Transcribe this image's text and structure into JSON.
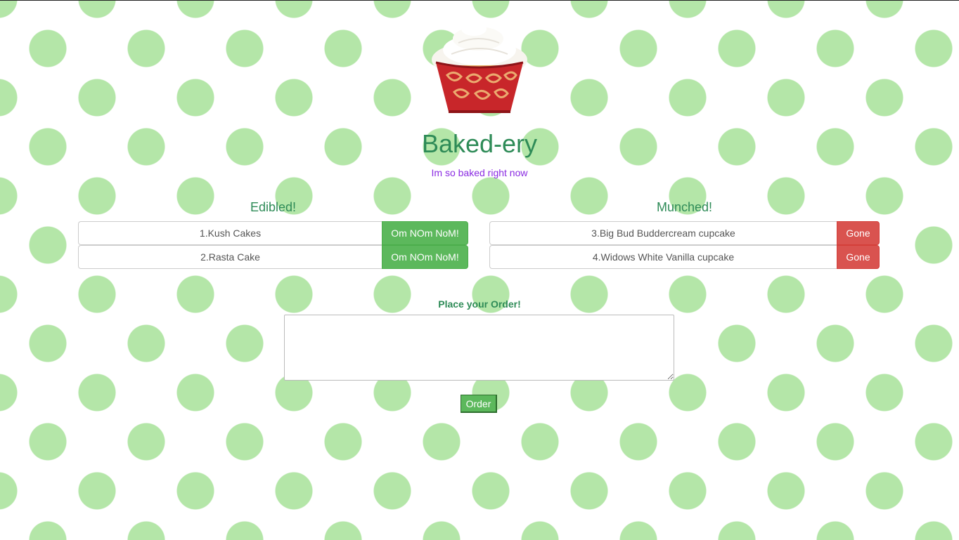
{
  "header": {
    "title": "Baked-ery",
    "subtitle": "Im so baked right now",
    "logo_icon": "cupcake-icon"
  },
  "edible": {
    "heading": "Edibled!",
    "items": [
      {
        "label": "1.Kush Cakes",
        "button": "Om NOm NoM!"
      },
      {
        "label": "2.Rasta Cake",
        "button": "Om NOm NoM!"
      }
    ]
  },
  "munched": {
    "heading": "Munched!",
    "items": [
      {
        "label": "3.Big Bud Buddercream cupcake",
        "button": "Gone"
      },
      {
        "label": "4.Widows White Vanilla cupcake",
        "button": "Gone"
      }
    ]
  },
  "order": {
    "label": "Place your Order!",
    "value": "",
    "button": "Order"
  },
  "colors": {
    "accent_green": "#2e8b57",
    "subtitle_purple": "#8a2be2",
    "button_green": "#5cb85c",
    "button_red": "#d9534f",
    "polka_dot": "#b4e6a8"
  }
}
